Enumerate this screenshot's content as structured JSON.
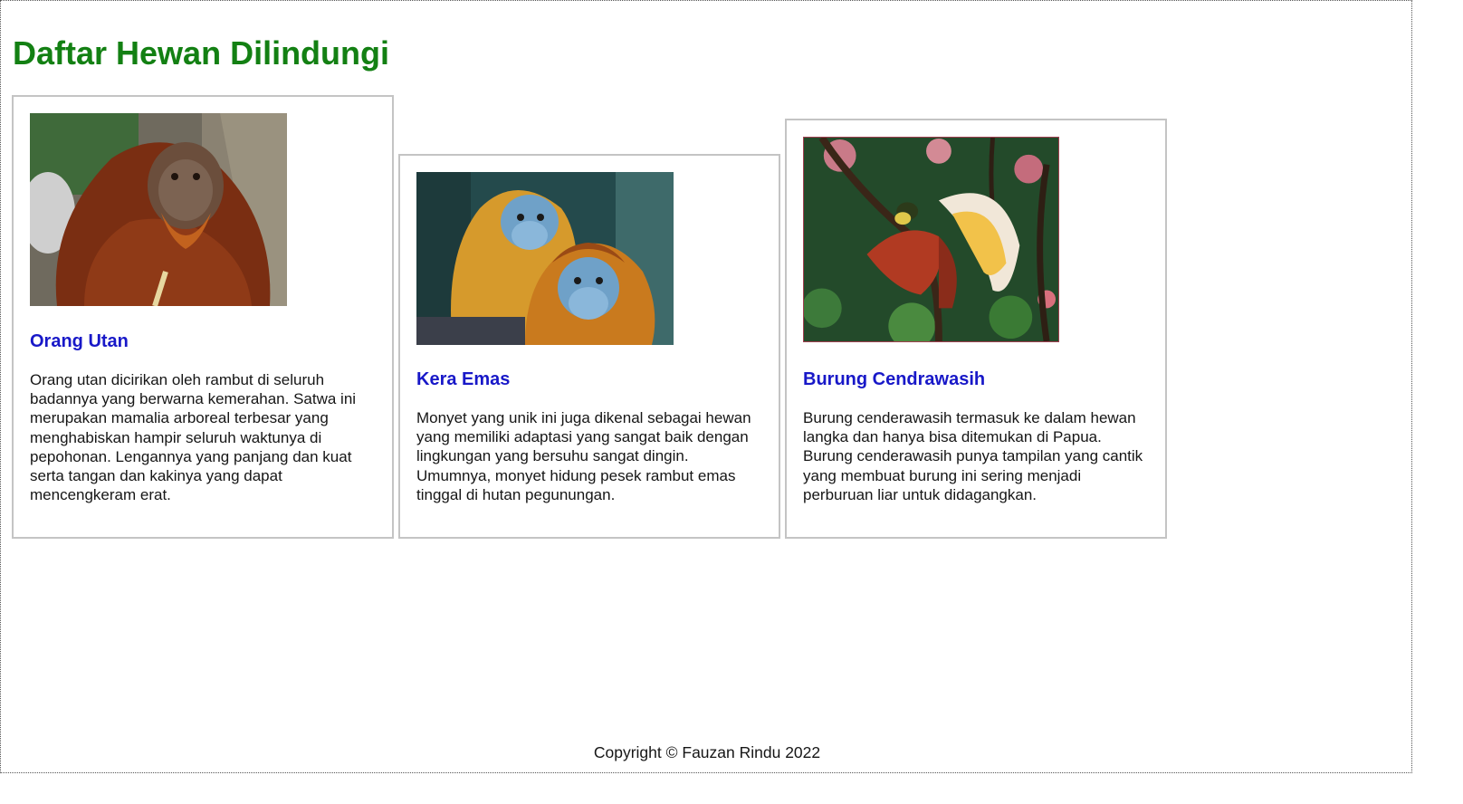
{
  "page": {
    "title": "Daftar Hewan Dilindungi",
    "footer": "Copyright © Fauzan Rindu 2022",
    "colors": {
      "title": "#138013",
      "card_title": "#1818c8",
      "text": "#161616",
      "card_border": "#c4c4c4"
    }
  },
  "cards": [
    {
      "image": "orangutan-photo",
      "title": "Orang Utan",
      "text": "Orang utan dicirikan oleh rambut di seluruh badannya yang berwarna kemerahan. Satwa ini merupakan mamalia arboreal terbesar yang menghabiskan hampir seluruh waktunya di pepohonan. Lengannya yang panjang dan kuat serta tangan dan kakinya yang dapat mencengkeram erat."
    },
    {
      "image": "golden-monkey-photo",
      "title": "Kera Emas",
      "text": "Monyet yang unik ini juga dikenal sebagai hewan yang memiliki adaptasi yang sangat baik dengan lingkungan yang bersuhu sangat dingin. Umumnya, monyet hidung pesek rambut emas tinggal di hutan pegunungan."
    },
    {
      "image": "bird-of-paradise-photo",
      "title": "Burung Cendrawasih",
      "text": "Burung cenderawasih termasuk ke dalam hewan langka dan hanya bisa ditemukan di Papua. Burung cenderawasih punya tampilan yang cantik yang membuat burung ini sering menjadi perburuan liar untuk didagangkan."
    }
  ]
}
